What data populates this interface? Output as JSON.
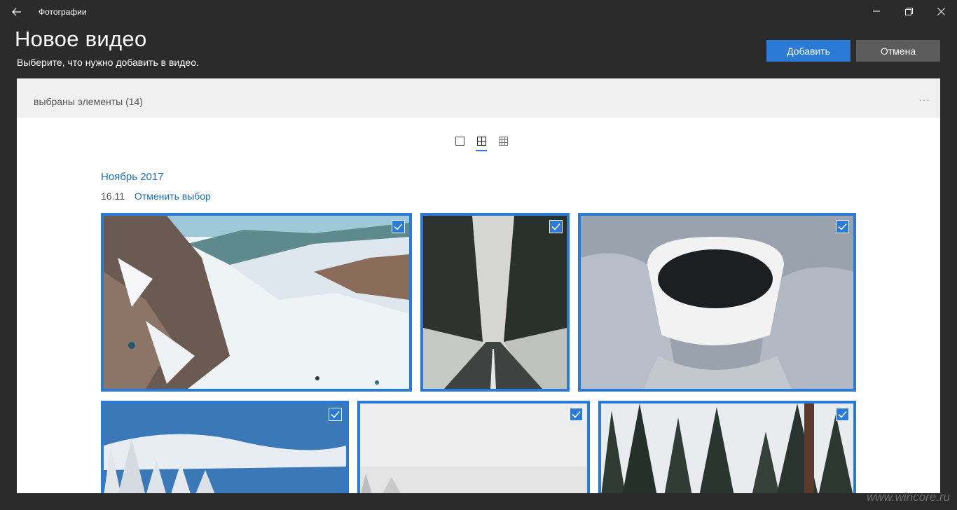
{
  "window": {
    "app_title": "Фотографии"
  },
  "header": {
    "title": "Новое видео",
    "subtitle": "Выберите, что нужно добавить в видео.",
    "add_label": "Добавить",
    "cancel_label": "Отмена"
  },
  "panel": {
    "selected_count": "выбраны элементы (14)",
    "more_label": "···",
    "view_modes": [
      "single",
      "grid-medium",
      "grid-small"
    ],
    "active_view": "grid-medium",
    "month": "Ноябрь 2017",
    "date": "16.11",
    "deselect_label": "Отменить выбор",
    "photos": [
      {
        "subject": "snowy-mountain-skiers",
        "selected": true
      },
      {
        "subject": "forest-road-winter",
        "selected": true
      },
      {
        "subject": "coffee-cup-knit-mittens",
        "selected": true
      },
      {
        "subject": "snowy-trees-blue-sky",
        "selected": true
      },
      {
        "subject": "foggy-snow-field",
        "selected": true
      },
      {
        "subject": "snowy-pine-forest",
        "selected": true
      }
    ]
  },
  "watermark": "www.wincore.ru",
  "colors": {
    "accent": "#2b7bd6",
    "chrome_bg": "#2b2b2b",
    "cancel_bg": "#5c5c5c",
    "link": "#1c6fbf"
  }
}
